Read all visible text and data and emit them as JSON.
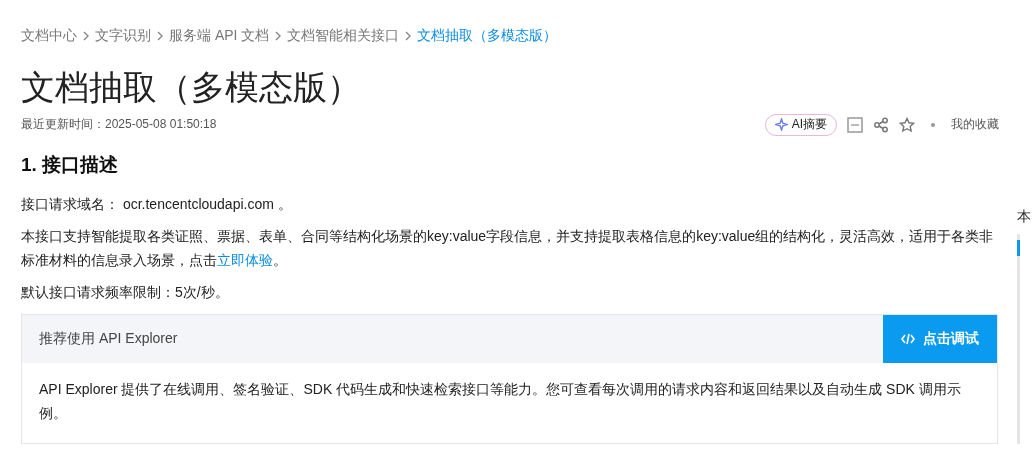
{
  "breadcrumb": [
    {
      "label": "文档中心",
      "selected": false
    },
    {
      "label": "文字识别",
      "selected": false
    },
    {
      "label": "服务端 API 文档",
      "selected": false
    },
    {
      "label": "文档智能相关接口",
      "selected": false
    },
    {
      "label": "文档抽取（多模态版）",
      "selected": true
    }
  ],
  "title": "文档抽取（多模态版）",
  "updated": "最近更新时间：2025-05-08 01:50:18",
  "actions": {
    "ai_summary": "AI摘要",
    "favorites": "我的收藏"
  },
  "section_heading": "1. 接口描述",
  "domain_line": "接口请求域名： ocr.tencentcloudapi.com 。",
  "intro": {
    "before": "本接口支持智能提取各类证照、票据、表单、合同等结构化场景的key:value字段信息，并支持提取表格信息的key:value组的结构化，灵活高效，适用于各类非标准材料的信息录入场景，点击",
    "link": "立即体验",
    "after": "。"
  },
  "rate_limit": "默认接口请求频率限制：5次/秒。",
  "explorer": {
    "title": "推荐使用 API Explorer",
    "button": "点击调试",
    "body": "API Explorer 提供了在线调用、签名验证、SDK 代码生成和快速检索接口等能力。您可查看每次调用的请求内容和返回结果以及自动生成 SDK 调用示例。"
  },
  "toc": {
    "heading": "本"
  }
}
